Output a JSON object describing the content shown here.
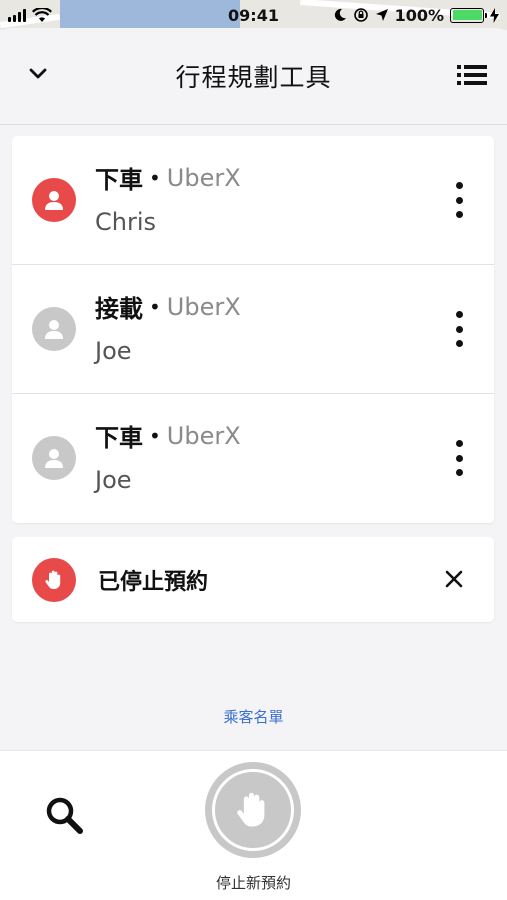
{
  "status_bar": {
    "time": "09:41",
    "battery": "100%",
    "battery_level": 1.0
  },
  "header": {
    "title": "行程規劃工具",
    "collapse_icon": "chevron-down-icon",
    "list_icon": "list-icon"
  },
  "trips": [
    {
      "action": "下車",
      "separator": "•",
      "product": "UberX",
      "rider": "Chris",
      "avatar_color": "#e84a4a",
      "avatar_icon": "person-icon"
    },
    {
      "action": "接載",
      "separator": "•",
      "product": "UberX",
      "rider": "Joe",
      "avatar_color": "#c8c8c8",
      "avatar_icon": "person-icon"
    },
    {
      "action": "下車",
      "separator": "•",
      "product": "UberX",
      "rider": "Joe",
      "avatar_color": "#c8c8c8",
      "avatar_icon": "person-icon"
    }
  ],
  "stopped_notice": {
    "label": "已停止預約",
    "icon": "hand-stop-icon",
    "icon_color": "#e84a4a"
  },
  "manifest_link": "乘客名單",
  "bottom_bar": {
    "search_icon": "search-icon",
    "stop_button_icon": "hand-stop-icon",
    "stop_label": "停止新預約"
  },
  "colors": {
    "accent_red": "#e84a4a",
    "link_blue": "#3b6fd0",
    "inactive_grey": "#c8c8c8"
  }
}
